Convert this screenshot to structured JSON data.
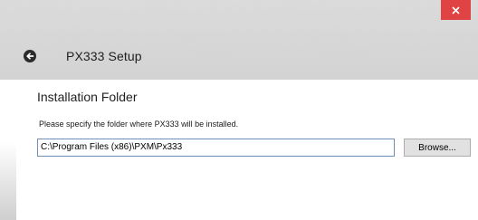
{
  "window": {
    "title": "PX333 Setup",
    "close_icon": "close-icon",
    "back_icon": "back-arrow-icon"
  },
  "page": {
    "heading": "Installation Folder",
    "instruction": "Please specify the folder where PX333 will be installed.",
    "folder_path": "C:\\Program Files (x86)\\PXM\\Px333",
    "browse_label": "Browse..."
  },
  "colors": {
    "header_bg": "#d5d5d5",
    "close_button": "#e04343",
    "input_border": "#6f8fb8"
  }
}
